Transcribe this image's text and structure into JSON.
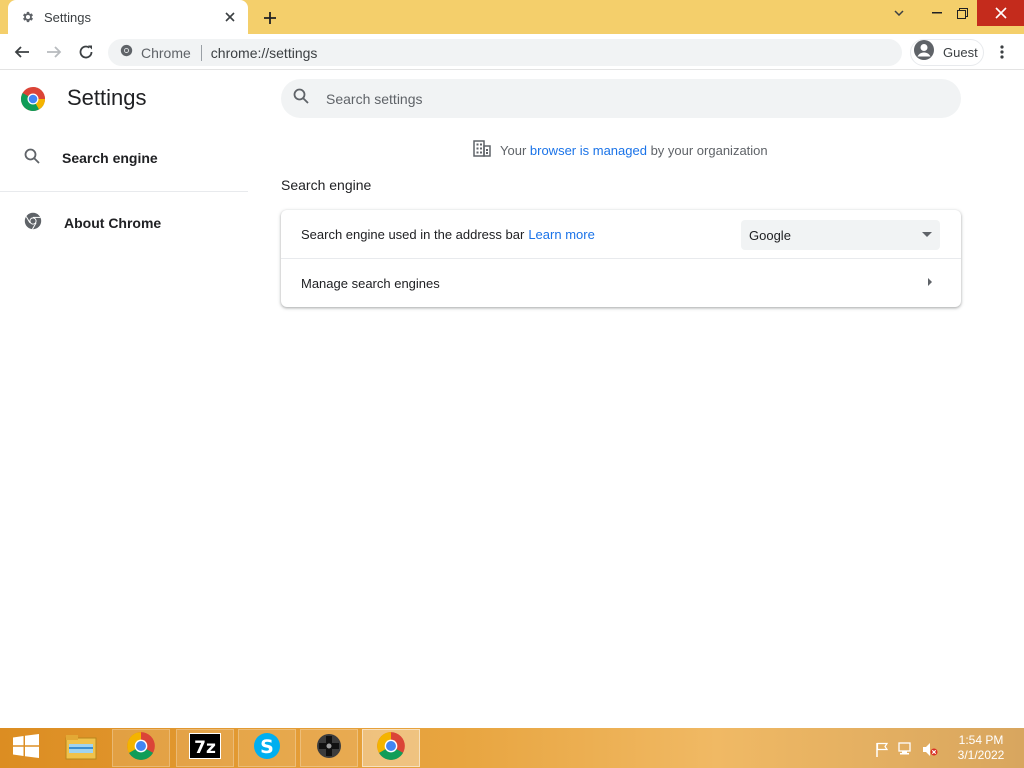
{
  "browser": {
    "tab_title": "Settings",
    "omnibox_chip": "Chrome",
    "url": "chrome://settings",
    "profile_label": "Guest"
  },
  "settings": {
    "page_title": "Settings",
    "search_placeholder": "Search settings",
    "sidebar": {
      "items": [
        {
          "label": "Search engine",
          "icon": "search-icon"
        },
        {
          "label": "About Chrome",
          "icon": "chrome-icon"
        }
      ]
    },
    "managed_notice": {
      "prefix": "Your ",
      "link": "browser is managed",
      "suffix": " by your organization"
    },
    "section_title": "Search engine",
    "card": {
      "row1_label": "Search engine used in the address bar",
      "row1_link": "Learn more",
      "row1_value": "Google",
      "row2_label": "Manage search engines"
    }
  },
  "taskbar": {
    "apps": [
      "file-explorer-icon",
      "chrome-icon",
      "7zip-icon",
      "skype-icon",
      "game-controller-icon",
      "chrome-icon"
    ],
    "clock_time": "1:54 PM",
    "clock_date": "3/1/2022"
  },
  "colors": {
    "titlebar": "#f4cf6b",
    "link": "#1a73e8",
    "close_button": "#c42b1c"
  }
}
